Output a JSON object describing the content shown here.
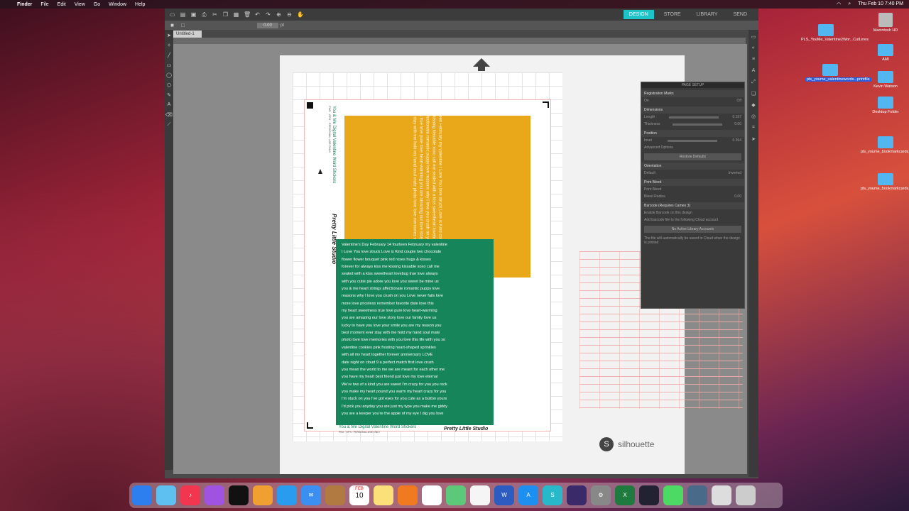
{
  "menubar": {
    "app": "Finder",
    "items": [
      "File",
      "Edit",
      "View",
      "Go",
      "Window",
      "Help"
    ],
    "clock": "Thu Feb 10  7:40 PM"
  },
  "toolbar": {
    "tabs": [
      "DESIGN",
      "STORE",
      "LIBRARY",
      "SEND"
    ],
    "active_tab": "DESIGN"
  },
  "doc": {
    "tab_label": "Untitled-1",
    "line_weight": "0.00",
    "unit": "pt"
  },
  "design": {
    "yellow_text": "Valentine's Day February 14 fourteen February my valentine I Love You love struck Love is Kind couple two chocolate flower flower bouquet pink red roses hugs & kisses forever for always kiss me kissing kissable xoxo call me sealed with a kiss sweetheart lovebug true love always with you cutie pie adore you love you sweet be mine us you & me heart strings affectionate romantic puppy love reasons why I love you crush on you Love never fails love more love priceless remember favorite date love this my heart sweetness true love pure love heart-warming you are amazing our love story love our family love us lucky to have you love your smile you are my reason you best moment ever stay with me hold my hand soul mate photo love love memories with you love this life with you xo",
    "green_lines": [
      "Valentine's Day   February 14   fourteen   February   my valentine",
      "I Love You    love struck    Love is Kind    couple    two    chocolate",
      "flower    flower bouquet    pink    red    roses    hugs & kisses",
      "forever    for always    kiss me    kissing    kissable    xoxo    call me",
      "sealed with a kiss    sweetheart    lovebug    true love    always",
      "with you    cutie pie    adore you    love you    sweet    be mine    us",
      "you & me    heart strings    affectionate    romantic    puppy love",
      "reasons why I love you    crush on you    Love never fails    love",
      "more love    priceless    remember    favorite date    love this",
      "my heart    sweetness    true love    pure love    heart-warming",
      "you are amazing    our love story    love our family    love us",
      "lucky to have you    love your smile    you are my reason    you",
      "best moment ever    stay with me    hold my hand    soul mate",
      "photo love    love memories with you    love this life with you    xo",
      "valentine cookies    pink frosting    heart-shaped    sprinkles",
      "with all my heart    together forever    anniversary    LOVE",
      "date night    on cloud 9    a perfect match    first love    crush",
      "you mean the world to me    we are meant for each other    me",
      "you have my heart    best friend    just love    my love    eternal",
      "We're two of a kind    you are sweet    I'm crazy for you    you rock",
      "you make my heart pound    you warm my heart    crazy for you",
      "I'm stuck on you    I've got eyes for you    cute as a button    yours",
      "I'd pick you anyday    you are just my type    you make me giddy",
      "you are a keeper    you're the apple of my eye    I dig you    love"
    ],
    "title": "You & Me Digital Valentine Word Stickers",
    "subtitle": "PNG · EPS · PERSONAL USE ONLY",
    "signature": "Pretty Little Studio"
  },
  "brand": {
    "name": "silhouette"
  },
  "panel": {
    "title": "PAGE SETUP",
    "registration_marks": "Registration Marks",
    "on": "On",
    "off": "Off",
    "dimensions": "Dimensions",
    "length": "Length",
    "length_val": "0.197",
    "thickness": "Thickness",
    "thickness_val": "0.00",
    "position": "Position",
    "inset": "Inset",
    "inset_val": "0.394",
    "advanced": "Advanced Options",
    "restore": "Restore Defaults",
    "orientation": "Orientation",
    "default": "Default",
    "inverted": "Inverted",
    "print_bleed": "Print Bleed",
    "print_bleed_chk": "Print Bleed",
    "bleed_radius": "Bleed Radius",
    "bleed_val": "0.00",
    "barcode": "Barcode (Requires Cameo 3)",
    "enable_barcode": "Enable Barcode on this design",
    "add_barcode": "Add barcode file to the following Cloud account",
    "no_accounts": "No Active Library Accounts",
    "note": "The file will automatically be saved to Cloud when the design is printed"
  },
  "desktop": {
    "icons": [
      {
        "label": "PLS_YouMe_Valentine2Wor...CutLines"
      },
      {
        "label": "Macintosh HD"
      },
      {
        "label": "AMI"
      },
      {
        "label": "pls_youme_valentinewords...printfile"
      },
      {
        "label": "Kevin Watson"
      },
      {
        "label": "Desktop Folder"
      },
      {
        "label": "pls_youme_bookmarkcards_png"
      },
      {
        "label": "pls_youme_bookmarkcards_cutlines"
      }
    ]
  },
  "dock": {
    "calendar_month": "FEB",
    "calendar_day": "10"
  }
}
